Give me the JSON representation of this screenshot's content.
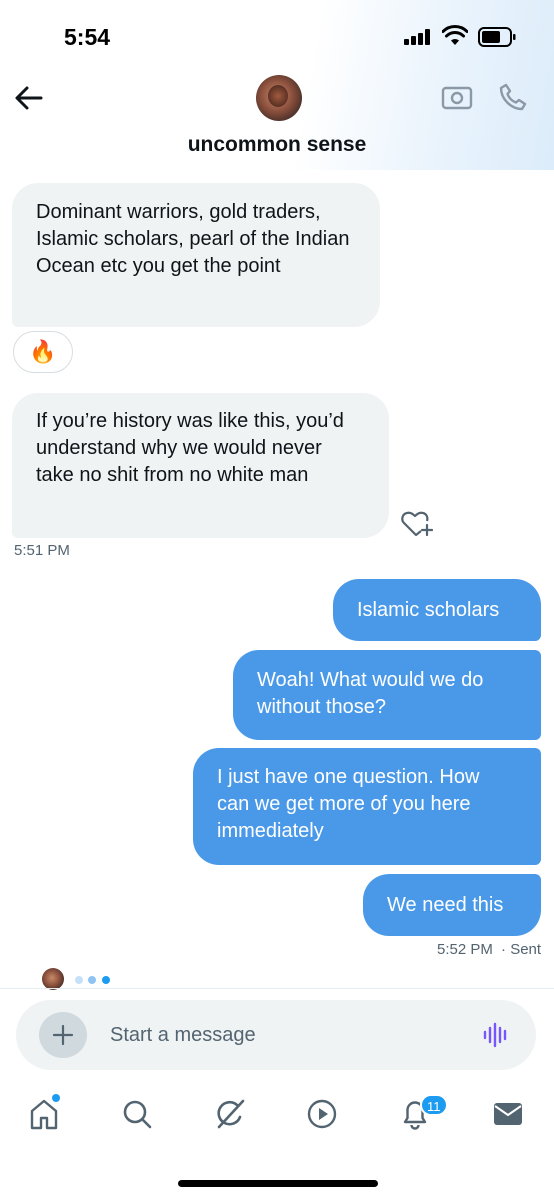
{
  "status_bar": {
    "time": "5:54"
  },
  "header": {
    "title": "uncommon sense"
  },
  "messages": {
    "recv1": "Dominant warriors, gold traders, Islamic scholars, pearl of the Indian Ocean etc you get the point",
    "reaction": "🔥",
    "recv2": "If you’re history was like this, you’d understand why we would never take no shit from no white man",
    "recv_time": "5:51 PM",
    "sent1": "Islamic scholars",
    "sent2": "Woah! What would we do without those?",
    "sent3": "I just have one question. How can we get more of you here immediately",
    "sent4": "We need this",
    "sent_time": "5:52 PM",
    "sent_status": "· Sent"
  },
  "composer": {
    "placeholder": "Start a message"
  },
  "nav": {
    "notifications_count": "11"
  },
  "colors": {
    "accent": "#1d9bf0",
    "sent_bubble": "#4a99e9",
    "received_bubble": "#eff3f4",
    "voice_icon": "#7856ff"
  }
}
